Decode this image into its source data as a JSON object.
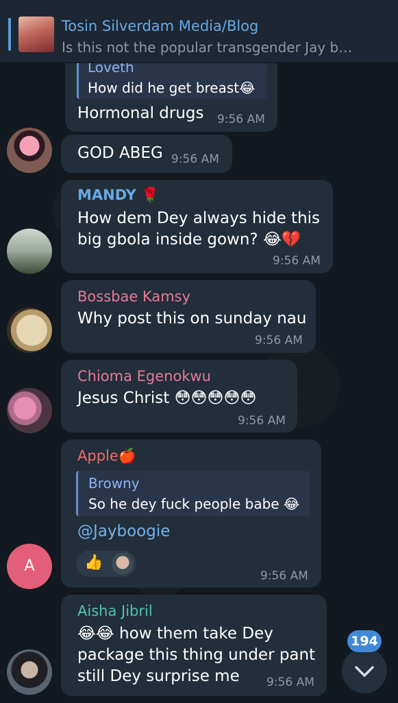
{
  "pinned": {
    "title": "Tosin Silverdam Media/Blog",
    "text": "Is this not the popular transgender Jay b…"
  },
  "messages": [
    {
      "quote_name": "Loveth",
      "quote_text": "How did he get breast😂",
      "text": "Hormonal drugs",
      "time": "9:56 AM"
    },
    {
      "text": "GOD ABEG",
      "time": "9:56 AM"
    },
    {
      "sender": "MANDY 🌹",
      "sender_color": "#66a9e6",
      "line1": "How dem Dey always hide this",
      "line2": "big gbola inside gown? 😂💔",
      "time": "9:56 AM"
    },
    {
      "sender": "Bossbae Kamsy",
      "sender_color": "#e6799a",
      "text": "Why post this on sunday nau",
      "time": "9:56 AM"
    },
    {
      "sender": "Chioma Egenokwu",
      "sender_color": "#e6799a",
      "text": "Jesus Christ 😳😳😳😳😳",
      "time": "9:56 AM"
    },
    {
      "sender": "Apple🍎",
      "sender_color": "#ee6a6a",
      "quote_name": "Browny",
      "quote_text": "So he dey fuck people babe 😂",
      "mention": "@Jayboogie",
      "reaction": "👍",
      "time": "9:56 AM",
      "avatar_letter": "A",
      "avatar_color": "#e35e78"
    },
    {
      "sender": "Aisha Jibril",
      "sender_color": "#4fc3b8",
      "line1": "😂😂 how them take Dey",
      "line2": "package this thing under pant",
      "line3": "still Dey surprise me",
      "time": "9:56 AM"
    }
  ],
  "unread_count": "194",
  "icons": {
    "scroll_down": "chevron-down-icon"
  }
}
